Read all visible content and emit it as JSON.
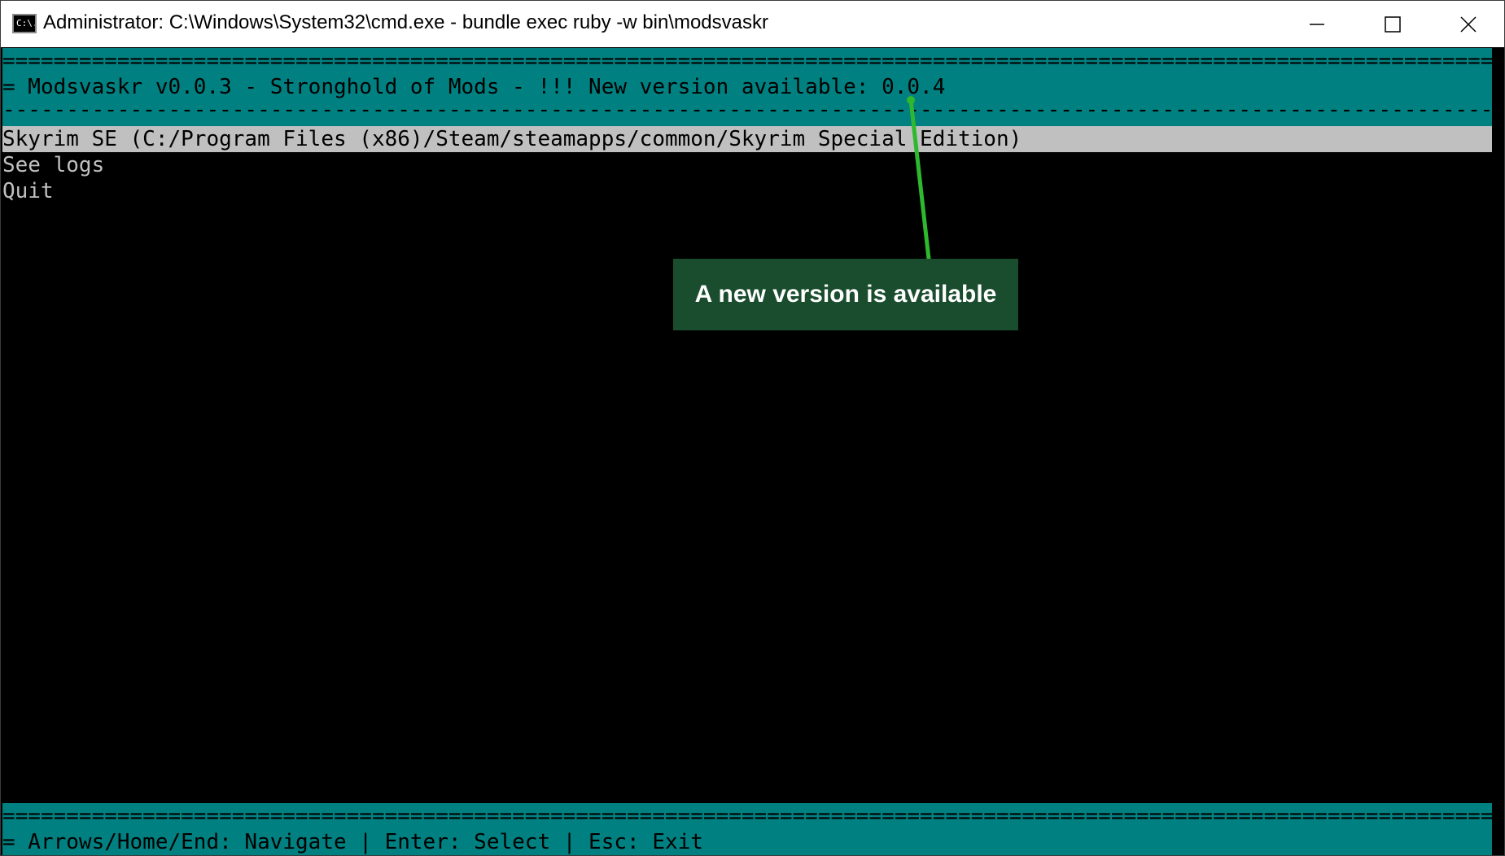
{
  "window": {
    "title": "Administrator: C:\\Windows\\System32\\cmd.exe - bundle  exec ruby -w bin\\modsvaskr",
    "icon_label": "C:\\."
  },
  "terminal": {
    "header_rule_top": "=================================================================================================================================================================",
    "header_line": "= Modsvaskr v0.0.3 - Stronghold of Mods - !!! New version available: 0.0.4",
    "header_rule_bottom": "-----------------------------------------------------------------------------------------------------------------------------------------------------------------",
    "menu_items": [
      "Skyrim SE (C:/Program Files (x86)/Steam/steamapps/common/Skyrim Special Edition)",
      "See logs",
      "Quit"
    ],
    "footer_rule": "=================================================================================================================================================================",
    "footer_line": "= Arrows/Home/End: Navigate | Enter: Select | Esc: Exit"
  },
  "annotation": {
    "text": "A new version is available"
  },
  "colors": {
    "teal": "#008080",
    "selected_bg": "#c0c0c0",
    "callout_bg": "#1a4d2e",
    "arrow": "#2eb82e"
  }
}
